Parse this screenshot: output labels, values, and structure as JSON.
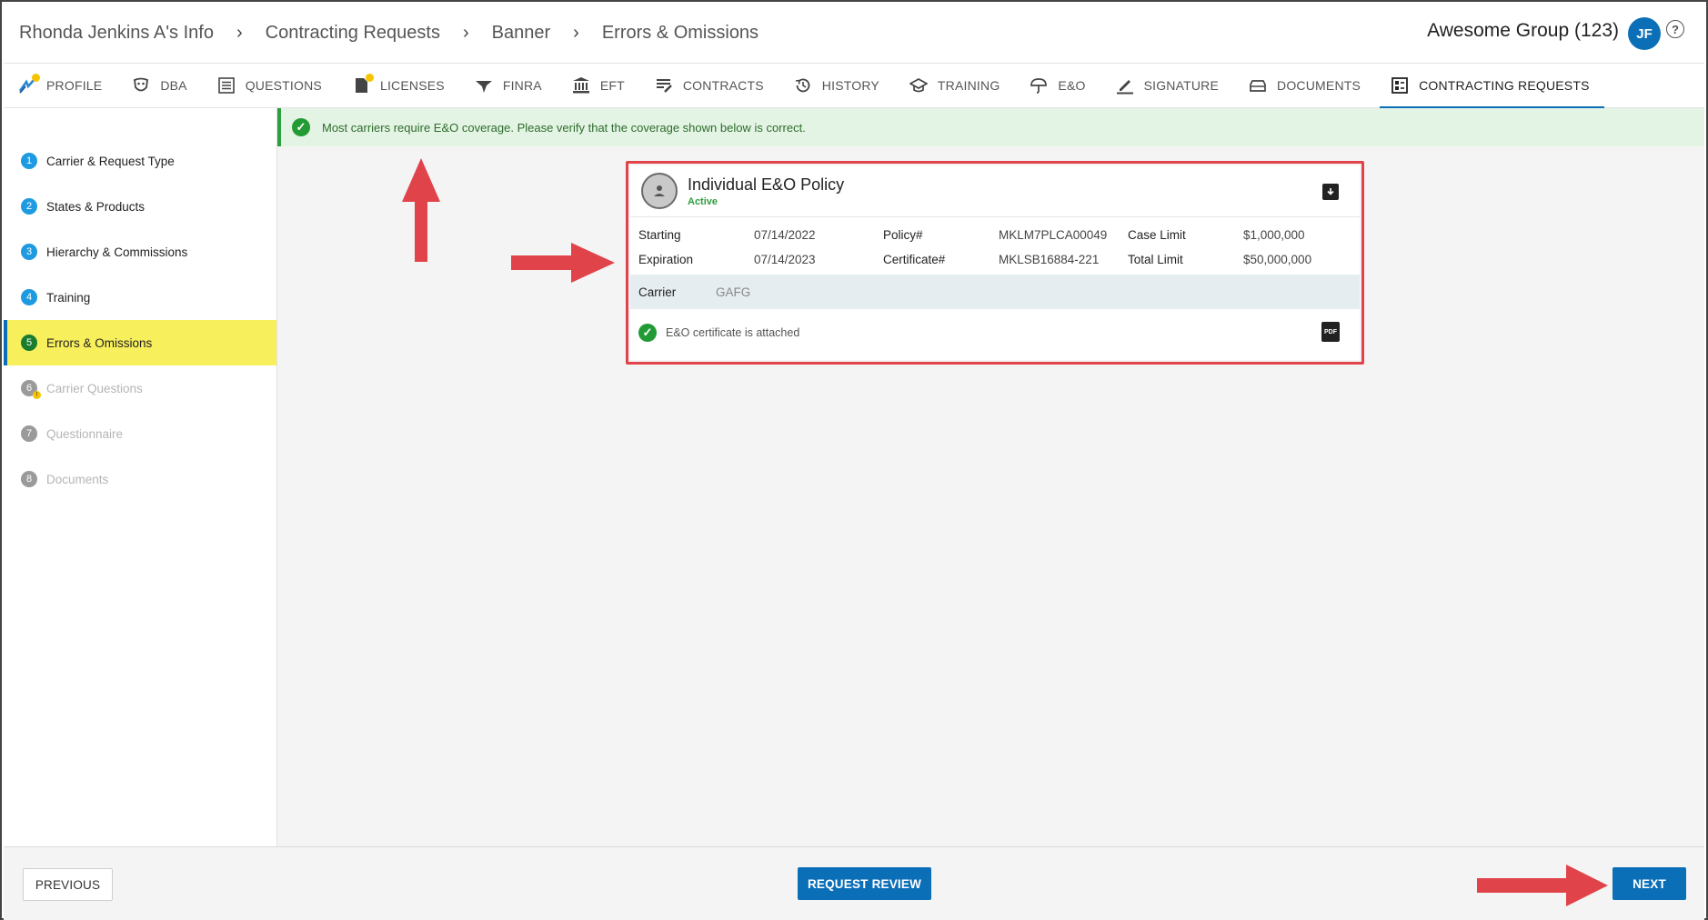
{
  "breadcrumb": {
    "items": [
      "Rhonda Jenkins A's Info",
      "Contracting Requests",
      "Banner",
      "Errors & Omissions"
    ]
  },
  "header": {
    "group_name": "Awesome Group (123)",
    "avatar_initials": "JF",
    "help_glyph": "?"
  },
  "tabs": [
    {
      "label": "PROFILE",
      "icon": "profile-icon",
      "badge": true
    },
    {
      "label": "DBA",
      "icon": "dba-mask-icon",
      "badge": false
    },
    {
      "label": "QUESTIONS",
      "icon": "questions-list-icon",
      "badge": false
    },
    {
      "label": "LICENSES",
      "icon": "license-icon",
      "badge": true
    },
    {
      "label": "FINRA",
      "icon": "finra-icon",
      "badge": false
    },
    {
      "label": "EFT",
      "icon": "bank-icon",
      "badge": false
    },
    {
      "label": "CONTRACTS",
      "icon": "contracts-icon",
      "badge": false
    },
    {
      "label": "HISTORY",
      "icon": "history-icon",
      "badge": false
    },
    {
      "label": "TRAINING",
      "icon": "training-cap-icon",
      "badge": false
    },
    {
      "label": "E&O",
      "icon": "umbrella-icon",
      "badge": false
    },
    {
      "label": "SIGNATURE",
      "icon": "signature-pen-icon",
      "badge": false
    },
    {
      "label": "DOCUMENTS",
      "icon": "documents-tray-icon",
      "badge": false
    },
    {
      "label": "CONTRACTING REQUESTS",
      "icon": "contracting-requests-icon",
      "badge": false,
      "active": true
    }
  ],
  "steps": [
    {
      "num": "1",
      "label": "Carrier & Request Type",
      "state": "complete"
    },
    {
      "num": "2",
      "label": "States & Products",
      "state": "complete"
    },
    {
      "num": "3",
      "label": "Hierarchy & Commissions",
      "state": "complete"
    },
    {
      "num": "4",
      "label": "Training",
      "state": "complete"
    },
    {
      "num": "5",
      "label": "Errors & Omissions",
      "state": "current"
    },
    {
      "num": "6",
      "label": "Carrier Questions",
      "state": "disabled",
      "warn": true
    },
    {
      "num": "7",
      "label": "Questionnaire",
      "state": "disabled"
    },
    {
      "num": "8",
      "label": "Documents",
      "state": "disabled"
    }
  ],
  "banner": {
    "message": "Most carriers require E&O coverage. Please verify that the coverage shown below is correct."
  },
  "policy": {
    "title": "Individual E&O Policy",
    "status": "Active",
    "starting_label": "Starting",
    "starting_value": "07/14/2022",
    "expiration_label": "Expiration",
    "expiration_value": "07/14/2023",
    "policy_label": "Policy#",
    "policy_value": "MKLM7PLCA00049",
    "certificate_label": "Certificate#",
    "certificate_value": "MKLSB16884-221",
    "case_limit_label": "Case Limit",
    "case_limit_value": "$1,000,000",
    "total_limit_label": "Total Limit",
    "total_limit_value": "$50,000,000",
    "carrier_label": "Carrier",
    "carrier_value": "GAFG",
    "attachment_text": "E&O certificate is attached",
    "pdf_glyph": "PDF"
  },
  "footer": {
    "previous_label": "PREVIOUS",
    "review_label": "REQUEST REVIEW",
    "next_label": "NEXT"
  },
  "colors": {
    "accent": "#0b6fb8",
    "highlight": "#f8ef5c",
    "success": "#239b35",
    "annotation": "#e0434a"
  }
}
